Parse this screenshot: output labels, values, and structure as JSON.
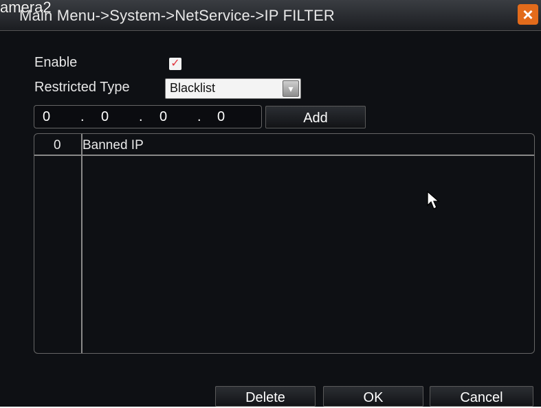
{
  "overlay": {
    "text": "amera2"
  },
  "window": {
    "title": "Main Menu->System->NetService->IP FILTER"
  },
  "form": {
    "enable_label": "Enable",
    "enable_checked": true,
    "restricted_type_label": "Restricted Type",
    "restricted_type_value": "Blacklist"
  },
  "ip_input": {
    "octets": [
      "0",
      "0",
      "0",
      "0"
    ],
    "dot": "."
  },
  "buttons": {
    "add": "Add",
    "delete": "Delete",
    "ok": "OK",
    "cancel": "Cancel"
  },
  "table": {
    "count": "0",
    "column_header": "Banned IP",
    "rows": []
  },
  "icons": {
    "close": "close-icon",
    "dropdown": "chevron-down-icon",
    "checkbox": "check-icon",
    "cursor": "mouse-pointer-icon"
  },
  "colors": {
    "accent_close": "#e26b1b",
    "checkbox_mark": "#e0323b"
  }
}
